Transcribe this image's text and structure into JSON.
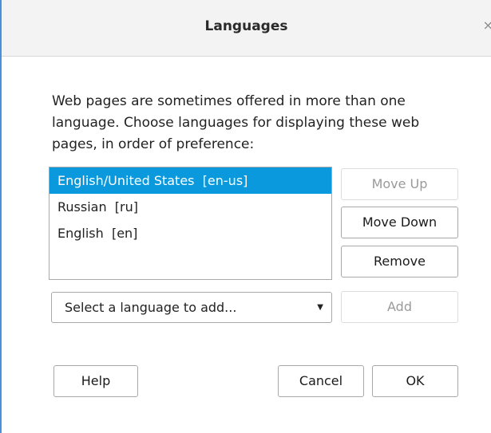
{
  "dialog": {
    "title": "Languages",
    "close_glyph": "×"
  },
  "description": "Web pages are sometimes offered in more than one language. Choose languages for displaying these web pages, in order of preference:",
  "languages": [
    {
      "label": "English/United States  [en-us]",
      "selected": true
    },
    {
      "label": "Russian  [ru]",
      "selected": false
    },
    {
      "label": "English  [en]",
      "selected": false
    }
  ],
  "buttons": {
    "move_up": "Move Up",
    "move_down": "Move Down",
    "remove": "Remove",
    "add": "Add",
    "help": "Help",
    "cancel": "Cancel",
    "ok": "OK"
  },
  "select": {
    "value": "Select a language to add..."
  },
  "colors": {
    "selection": "#0a99dc",
    "window_border": "#4a90d9"
  },
  "icons": {
    "close": "close-icon",
    "dropdown": "chevron-down-icon"
  }
}
